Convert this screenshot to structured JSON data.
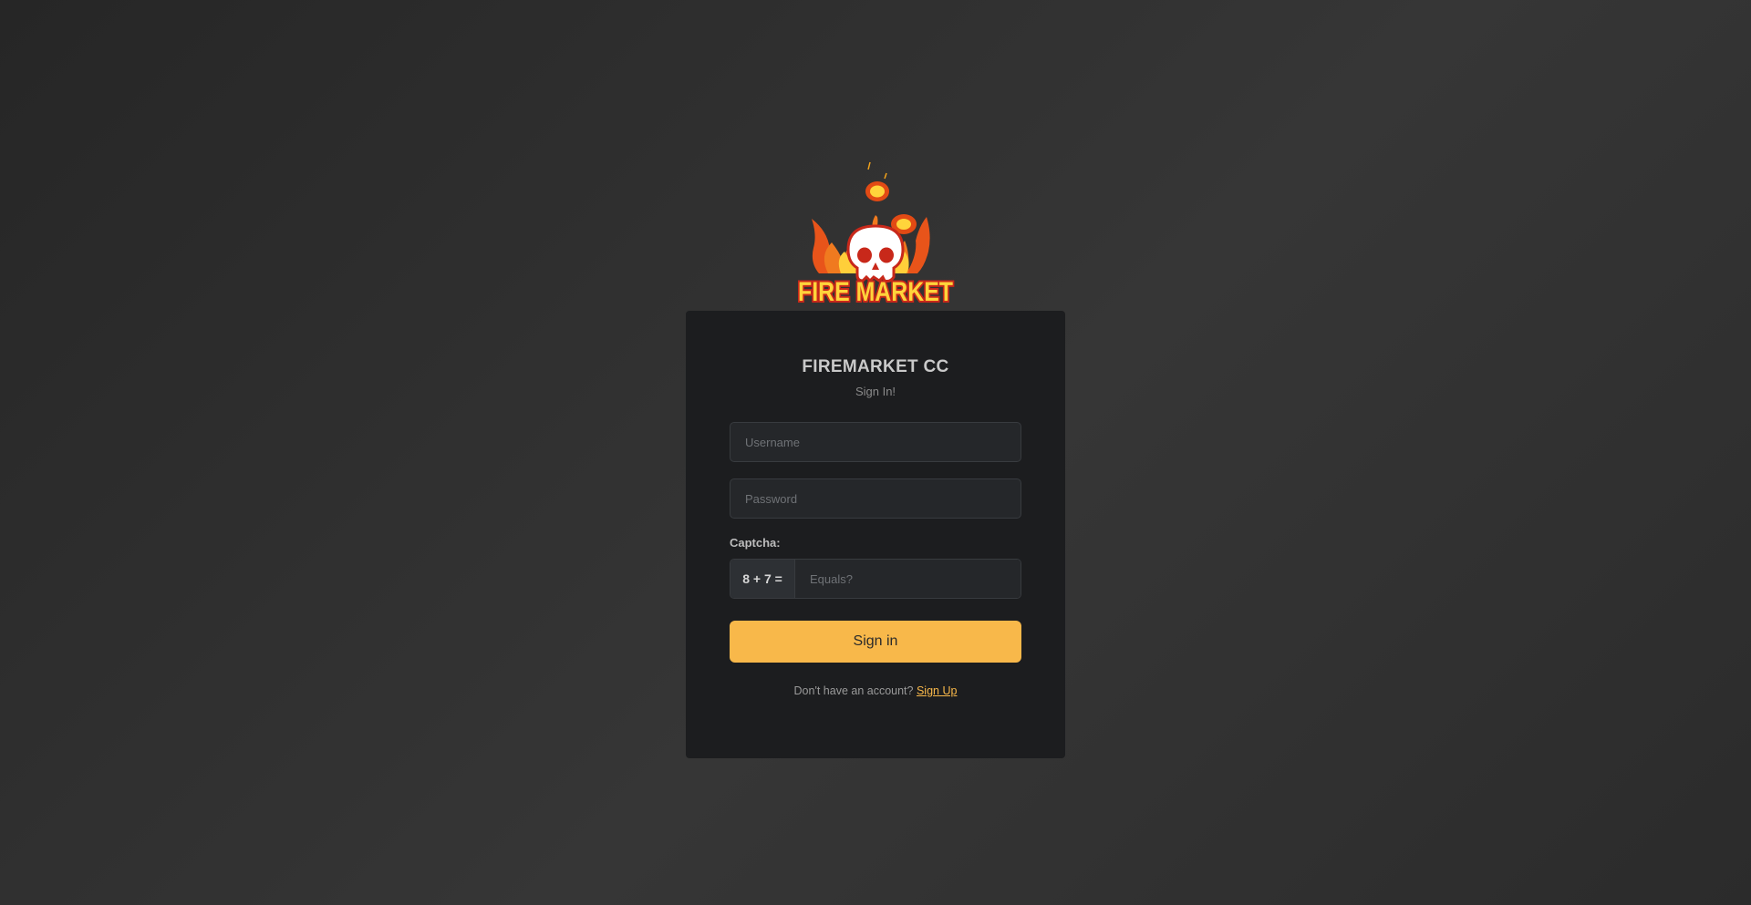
{
  "logo": {
    "icon": "fire-skull-logo",
    "text": "FIRE MARKET"
  },
  "card": {
    "title": "FIREMARKET CC",
    "subtitle": "Sign In!"
  },
  "form": {
    "username_placeholder": "Username",
    "password_placeholder": "Password",
    "captcha_label": "Captcha:",
    "captcha_question": "8 + 7 =",
    "captcha_placeholder": "Equals?",
    "submit_label": "Sign in"
  },
  "footer": {
    "prompt": "Don't have an account?",
    "signup_label": "Sign Up"
  },
  "colors": {
    "accent": "#f8b84a",
    "card_bg": "#1c1d1f",
    "field_bg": "#25272a"
  }
}
